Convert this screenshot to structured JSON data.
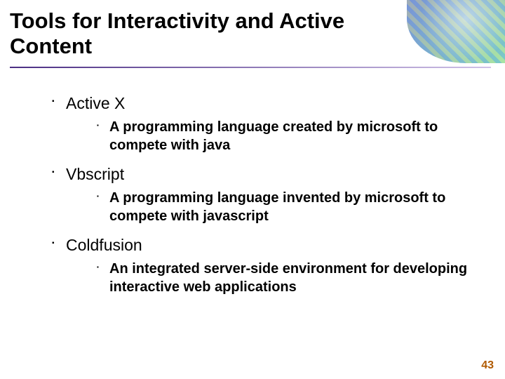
{
  "title": "Tools for Interactivity and Active Content",
  "items": [
    {
      "name": "Active X",
      "desc": "A programming language created by microsoft to compete with java"
    },
    {
      "name": "Vbscript",
      "desc": "A programming language invented by microsoft to compete with javascript"
    },
    {
      "name": "Coldfusion",
      "desc": "An integrated server-side environment for developing interactive web applications"
    }
  ],
  "bullet": "▪",
  "page_number": "43"
}
